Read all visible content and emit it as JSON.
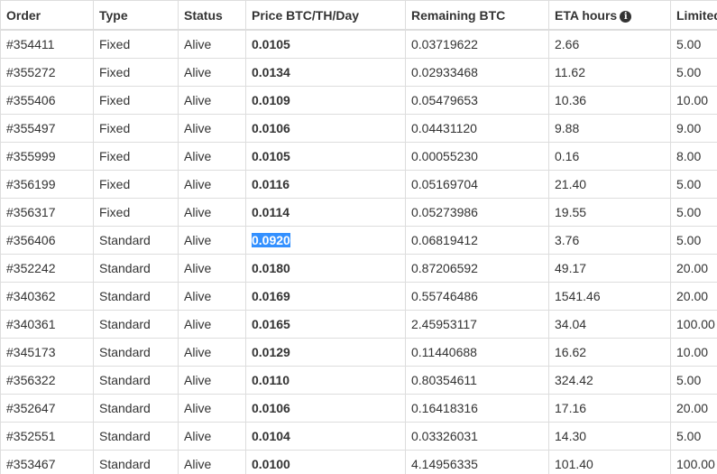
{
  "columns": {
    "order": "Order",
    "type": "Type",
    "status": "Status",
    "price": "Price BTC/TH/Day",
    "remaining": "Remaining BTC",
    "eta": "ETA hours",
    "limit": "Limited"
  },
  "eta_info_icon": "info-circle-icon",
  "selection_color": "#3390ff",
  "rows": [
    {
      "order": "#354411",
      "type": "Fixed",
      "status": "Alive",
      "price": "0.0105",
      "remaining": "0.03719622",
      "eta": "2.66",
      "limit": "5.00"
    },
    {
      "order": "#355272",
      "type": "Fixed",
      "status": "Alive",
      "price": "0.0134",
      "remaining": "0.02933468",
      "eta": "11.62",
      "limit": "5.00"
    },
    {
      "order": "#355406",
      "type": "Fixed",
      "status": "Alive",
      "price": "0.0109",
      "remaining": "0.05479653",
      "eta": "10.36",
      "limit": "10.00"
    },
    {
      "order": "#355497",
      "type": "Fixed",
      "status": "Alive",
      "price": "0.0106",
      "remaining": "0.04431120",
      "eta": "9.88",
      "limit": "9.00"
    },
    {
      "order": "#355999",
      "type": "Fixed",
      "status": "Alive",
      "price": "0.0105",
      "remaining": "0.00055230",
      "eta": "0.16",
      "limit": "8.00"
    },
    {
      "order": "#356199",
      "type": "Fixed",
      "status": "Alive",
      "price": "0.0116",
      "remaining": "0.05169704",
      "eta": "21.40",
      "limit": "5.00"
    },
    {
      "order": "#356317",
      "type": "Fixed",
      "status": "Alive",
      "price": "0.0114",
      "remaining": "0.05273986",
      "eta": "19.55",
      "limit": "5.00"
    },
    {
      "order": "#356406",
      "type": "Standard",
      "status": "Alive",
      "price": "0.0920",
      "remaining": "0.06819412",
      "eta": "3.76",
      "limit": "5.00",
      "selected": true
    },
    {
      "order": "#352242",
      "type": "Standard",
      "status": "Alive",
      "price": "0.0180",
      "remaining": "0.87206592",
      "eta": "49.17",
      "limit": "20.00"
    },
    {
      "order": "#340362",
      "type": "Standard",
      "status": "Alive",
      "price": "0.0169",
      "remaining": "0.55746486",
      "eta": "1541.46",
      "limit": "20.00"
    },
    {
      "order": "#340361",
      "type": "Standard",
      "status": "Alive",
      "price": "0.0165",
      "remaining": "2.45953117",
      "eta": "34.04",
      "limit": "100.00"
    },
    {
      "order": "#345173",
      "type": "Standard",
      "status": "Alive",
      "price": "0.0129",
      "remaining": "0.11440688",
      "eta": "16.62",
      "limit": "10.00"
    },
    {
      "order": "#356322",
      "type": "Standard",
      "status": "Alive",
      "price": "0.0110",
      "remaining": "0.80354611",
      "eta": "324.42",
      "limit": "5.00"
    },
    {
      "order": "#352647",
      "type": "Standard",
      "status": "Alive",
      "price": "0.0106",
      "remaining": "0.16418316",
      "eta": "17.16",
      "limit": "20.00"
    },
    {
      "order": "#352551",
      "type": "Standard",
      "status": "Alive",
      "price": "0.0104",
      "remaining": "0.03326031",
      "eta": "14.30",
      "limit": "5.00"
    },
    {
      "order": "#353467",
      "type": "Standard",
      "status": "Alive",
      "price": "0.0100",
      "remaining": "4.14956335",
      "eta": "101.40",
      "limit": "100.00"
    }
  ]
}
